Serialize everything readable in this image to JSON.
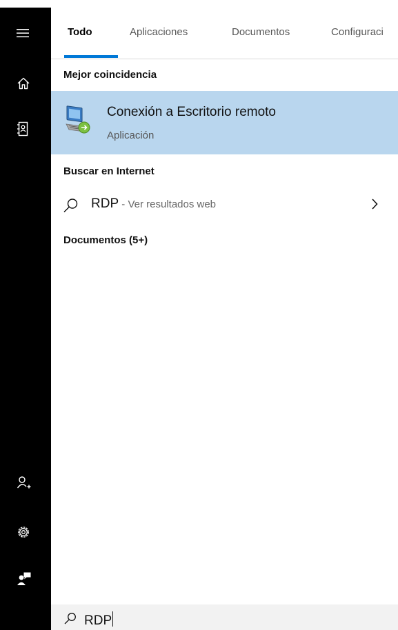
{
  "tabs": [
    {
      "label": "Todo"
    },
    {
      "label": "Aplicaciones"
    },
    {
      "label": "Documentos"
    },
    {
      "label": "Configuraci"
    }
  ],
  "sections": {
    "best_match": "Mejor coincidencia",
    "search_web": "Buscar en Internet",
    "documents": "Documentos (5+)"
  },
  "best_match": {
    "title": "Conexión a Escritorio remoto",
    "subtitle": "Aplicación",
    "icon": "remote-desktop-icon"
  },
  "web_result": {
    "query": "RDP",
    "hint": " - Ver resultados web"
  },
  "search": {
    "value": "RDP"
  },
  "sidebar": {
    "icons": [
      "hamburger-icon",
      "home-icon",
      "notebook-icon",
      "add-user-icon",
      "gear-icon",
      "feedback-icon"
    ]
  },
  "colors": {
    "sidebar_bg": "#000000",
    "selected_bg": "#b9d6ee",
    "accent": "#0078d7",
    "searchbar_bg": "#f2f2f2"
  }
}
